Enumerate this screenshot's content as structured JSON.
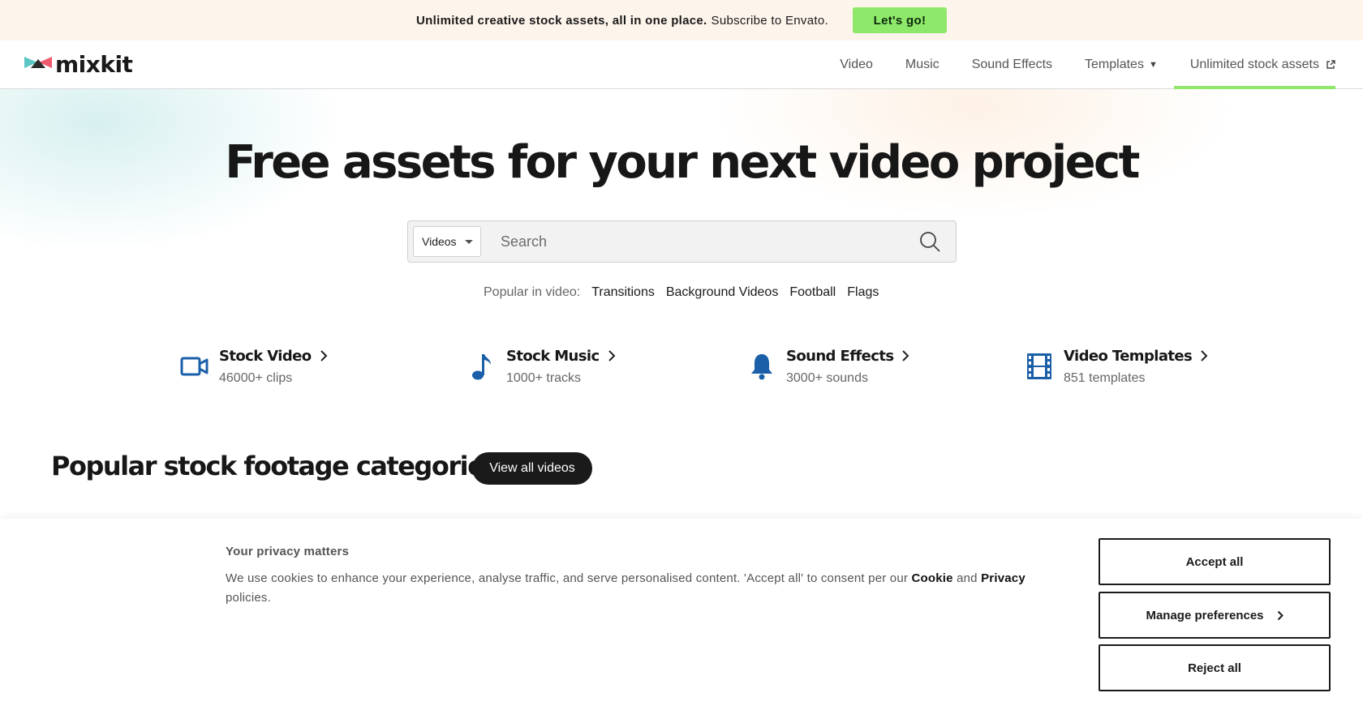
{
  "promo": {
    "text_strong": "Unlimited creative stock assets, all in one place.",
    "text_light": "Subscribe to Envato.",
    "cta": "Let's go!",
    "cta_color": "#8ee86a"
  },
  "header": {
    "logo": "mixkit",
    "nav": {
      "video": "Video",
      "music": "Music",
      "sound_effects": "Sound Effects",
      "templates": "Templates",
      "unlimited": "Unlimited stock assets"
    },
    "active_underline_color": "#8ee86a"
  },
  "hero": {
    "title": "Free assets for your next video project",
    "search": {
      "category": "Videos",
      "placeholder": "Search"
    },
    "popular": {
      "label": "Popular in video:",
      "links": [
        "Transitions",
        "Background Videos",
        "Football",
        "Flags"
      ]
    }
  },
  "categories": [
    {
      "title": "Stock Video",
      "count": "46000+ clips",
      "icon": "video-camera-icon"
    },
    {
      "title": "Stock Music",
      "count": "1000+ tracks",
      "icon": "music-note-icon"
    },
    {
      "title": "Sound Effects",
      "count": "3000+ sounds",
      "icon": "bell-icon"
    },
    {
      "title": "Video Templates",
      "count": "851 templates",
      "icon": "film-strip-icon"
    }
  ],
  "category_icon_color": "#1b5fa8",
  "section": {
    "title": "Popular stock footage categories",
    "button": "View all videos"
  },
  "cookie": {
    "heading": "Your privacy matters",
    "text_before": "We use cookies to enhance your experience, analyse traffic, and serve personalised content. 'Accept all' to consent per our",
    "cookie_link": "Cookie",
    "and": "and",
    "privacy_link": "Privacy",
    "text_after": "policies.",
    "accept": "Accept all",
    "manage": "Manage preferences",
    "reject": "Reject all"
  }
}
